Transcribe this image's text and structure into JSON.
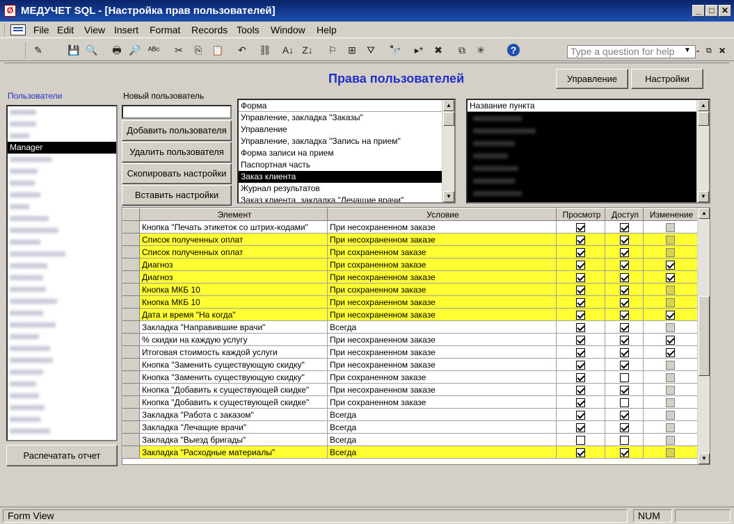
{
  "window": {
    "title": "МЕДУЧЕТ SQL - [Настройка прав пользователей]"
  },
  "menu": [
    "File",
    "Edit",
    "View",
    "Insert",
    "Format",
    "Records",
    "Tools",
    "Window",
    "Help"
  ],
  "ask": {
    "placeholder": "Type a question for help"
  },
  "toolbar_icons": [
    "view-icon",
    "save-icon",
    "search-file-icon",
    "print-icon",
    "print-preview-icon",
    "spelling-icon",
    "cut-icon",
    "copy-icon",
    "paste-icon",
    "undo-icon",
    "insert-hyperlink-icon",
    "sort-ascending-icon",
    "sort-descending-icon",
    "filter-by-selection-icon",
    "filter-by-form-icon",
    "apply-filter-icon",
    "find-icon",
    "new-record-icon",
    "delete-record-icon",
    "database-window-icon",
    "new-object-icon",
    "help-icon"
  ],
  "form": {
    "heading": "Права пользователей",
    "btn_manage": "Управление",
    "btn_settings": "Настройки",
    "users_label": "Пользователи",
    "new_user_label": "Новый пользователь",
    "new_user_value": "",
    "btn_add": "Добавить пользователя",
    "btn_delete": "Удалить пользователя",
    "btn_copy": "Скопировать настройки",
    "btn_paste": "Вставить настройки",
    "btn_report": "Распечатать отчет",
    "users": {
      "selected": "Manager",
      "hidden_count": 27
    },
    "forms_header": "Форма",
    "forms": [
      "Управление, закладка \"Заказы\"",
      "Управление",
      "Управление, закладка \"Запись на прием\"",
      "Форма записи на прием",
      "Паспортная часть",
      "Заказ клиента",
      "Журнал результатов",
      "Заказ клиента, закладка \"Лечащие врачи\""
    ],
    "forms_selected": 5,
    "items_header": "Название пункта",
    "grid": {
      "columns": [
        "Элемент",
        "Условие",
        "Просмотр",
        "Доступ",
        "Изменение"
      ],
      "rows": [
        {
          "el": "Кнопка \"Печать этикеток со штрих-кодами\"",
          "cond": "При несохраненном заказе",
          "v": 1,
          "d": 1,
          "c": 0,
          "hl": 0
        },
        {
          "el": "Список полученных оплат",
          "cond": "При несохраненном заказе",
          "v": 1,
          "d": 1,
          "c": 0,
          "hl": 1
        },
        {
          "el": "Список полученных оплат",
          "cond": "При сохраненном заказе",
          "v": 1,
          "d": 1,
          "c": 0,
          "hl": 1
        },
        {
          "el": "Диагноз",
          "cond": "При сохраненном заказе",
          "v": 1,
          "d": 1,
          "c": 1,
          "hl": 1
        },
        {
          "el": "Диагноз",
          "cond": "При несохраненном заказе",
          "v": 1,
          "d": 1,
          "c": 1,
          "hl": 1
        },
        {
          "el": "Кнопка МКБ 10",
          "cond": "При сохраненном заказе",
          "v": 1,
          "d": 1,
          "c": 0,
          "hl": 1
        },
        {
          "el": "Кнопка МКБ 10",
          "cond": "При несохраненном заказе",
          "v": 1,
          "d": 1,
          "c": 0,
          "hl": 1
        },
        {
          "el": "Дата и время \"На когда\"",
          "cond": "При несохраненном заказе",
          "v": 1,
          "d": 1,
          "c": 1,
          "hl": 1
        },
        {
          "el": "Закладка \"Направившие врачи\"",
          "cond": "Всегда",
          "v": 1,
          "d": 1,
          "c": 0,
          "hl": 0
        },
        {
          "el": "% скидки на каждую услугу",
          "cond": "При несохраненном заказе",
          "v": 1,
          "d": 1,
          "c": 1,
          "hl": 0
        },
        {
          "el": "Итоговая стоимость каждой услуги",
          "cond": "При несохраненном заказе",
          "v": 1,
          "d": 1,
          "c": 1,
          "hl": 0
        },
        {
          "el": "Кнопка \"Заменить существующую скидку\"",
          "cond": "При несохраненном заказе",
          "v": 1,
          "d": 1,
          "c": 0,
          "hl": 0
        },
        {
          "el": "Кнопка \"Заменить существующую скидку\"",
          "cond": "При сохраненном заказе",
          "v": 1,
          "d": 0,
          "c": 0,
          "hl": 0
        },
        {
          "el": "Кнопка \"Добавить к существующей скидке\"",
          "cond": "При несохраненном заказе",
          "v": 1,
          "d": 1,
          "c": 0,
          "hl": 0
        },
        {
          "el": "Кнопка \"Добавить к существующей скидке\"",
          "cond": "При сохраненном заказе",
          "v": 1,
          "d": 0,
          "c": 0,
          "hl": 0
        },
        {
          "el": "Закладка \"Работа с заказом\"",
          "cond": "Всегда",
          "v": 1,
          "d": 1,
          "c": 0,
          "hl": 0
        },
        {
          "el": "Закладка \"Лечащие врачи\"",
          "cond": "Всегда",
          "v": 1,
          "d": 1,
          "c": 0,
          "hl": 0
        },
        {
          "el": "Закладка \"Выезд бригады\"",
          "cond": "Всегда",
          "v": 0,
          "d": 0,
          "c": 0,
          "hl": 0
        },
        {
          "el": "Закладка \"Расходные материалы\"",
          "cond": "Всегда",
          "v": 1,
          "d": 1,
          "c": 0,
          "hl": 1
        }
      ]
    }
  },
  "status": {
    "left": "Form View",
    "num": "NUM"
  },
  "colors": {
    "highlight": "#ffff33",
    "heading": "#1f2fc8",
    "titlebar": "#0a246a"
  }
}
